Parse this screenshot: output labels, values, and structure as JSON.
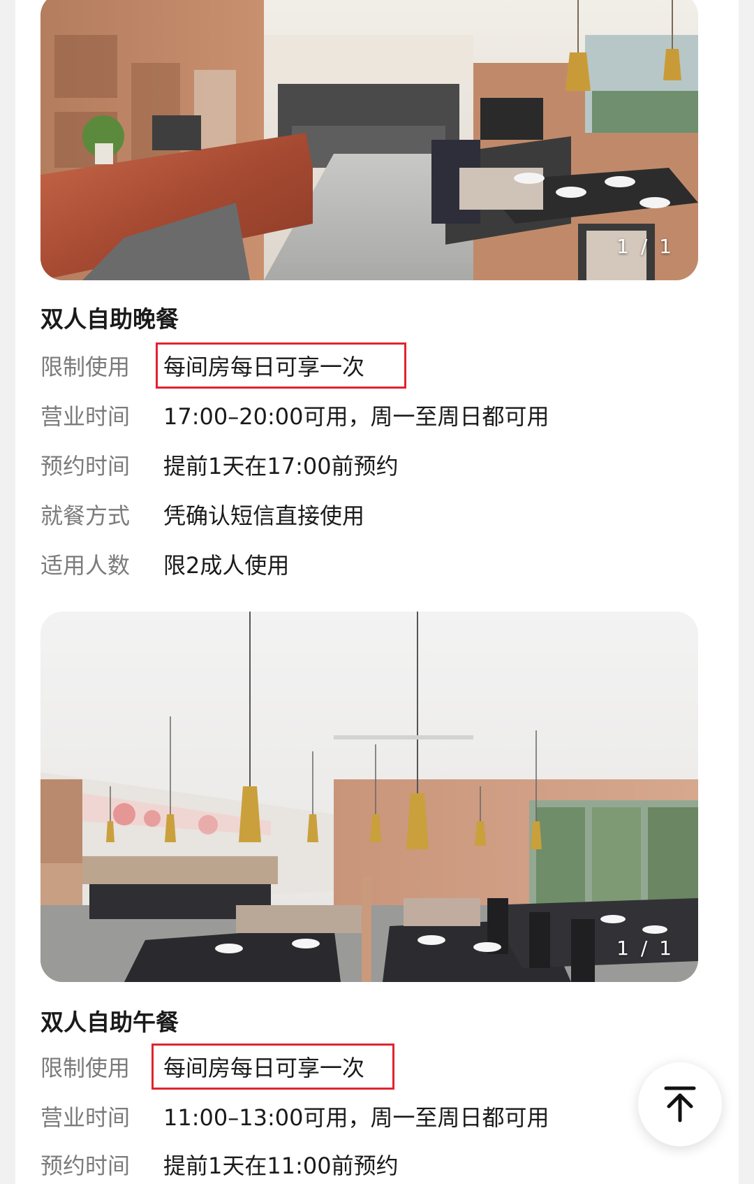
{
  "packages": [
    {
      "image": {
        "counter": "1 / 1",
        "scene": "restaurant-entrance-counter"
      },
      "title": "双人自助晚餐",
      "rows": [
        {
          "label": "限制使用",
          "value": "每间房每日可享一次",
          "highlighted": true
        },
        {
          "label": "营业时间",
          "value": "17:00–20:00可用，周一至周日都可用"
        },
        {
          "label": "预约时间",
          "value": "提前1天在17:00前预约"
        },
        {
          "label": "就餐方式",
          "value": "凭确认短信直接使用"
        },
        {
          "label": "适用人数",
          "value": "限2成人使用"
        }
      ]
    },
    {
      "image": {
        "counter": "1 / 1",
        "scene": "restaurant-dining-hall"
      },
      "title": "双人自助午餐",
      "rows": [
        {
          "label": "限制使用",
          "value": "每间房每日可享一次",
          "highlighted": true
        },
        {
          "label": "营业时间",
          "value": "11:00–13:00可用，周一至周日都可用"
        },
        {
          "label": "预约时间",
          "value": "提前1天在11:00前预约"
        }
      ]
    }
  ],
  "back_to_top": {
    "icon": "arrow-up-to-top-icon"
  },
  "colors": {
    "highlight_border": "#e0242f",
    "label": "#7b7b7b",
    "value": "#1a1a1a",
    "background": "#f1f1f1"
  }
}
